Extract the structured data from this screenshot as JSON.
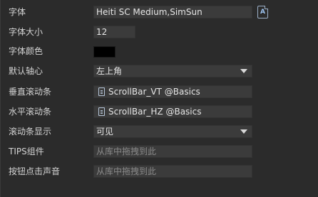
{
  "properties": {
    "font": {
      "label": "字体",
      "value": "Heiti SC Medium,SimSun",
      "button_icon": "font-file-icon"
    },
    "font_size": {
      "label": "字体大小",
      "value": "12"
    },
    "font_color": {
      "label": "字体颜色",
      "color": "#000000"
    },
    "anchor": {
      "label": "默认轴心",
      "value": "左上角"
    },
    "vscroll": {
      "label": "垂直滚动条",
      "value": "ScrollBar_VT @Basics",
      "icon": "document-icon"
    },
    "hscroll": {
      "label": "水平滚动条",
      "value": "ScrollBar_HZ @Basics",
      "icon": "document-icon"
    },
    "scroll_display": {
      "label": "滚动条显示",
      "value": "可见"
    },
    "tips": {
      "label": "TIPS组件",
      "placeholder": "从库中拖拽到此"
    },
    "click_sound": {
      "label": "按钮点击声音",
      "placeholder": "从库中拖拽到此"
    }
  }
}
